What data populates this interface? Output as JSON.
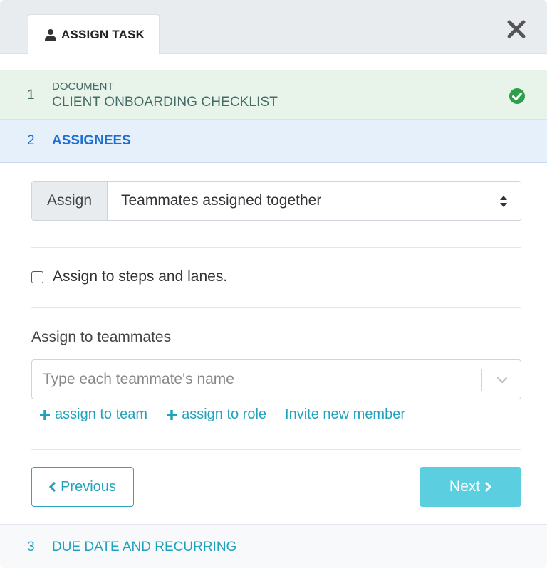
{
  "header": {
    "tab_label": "ASSIGN TASK",
    "tab_icon": "user-icon",
    "close_icon": "close-icon"
  },
  "steps": [
    {
      "number": "1",
      "subtitle": "DOCUMENT",
      "title": "CLIENT ONBOARDING CHECKLIST",
      "status": "complete"
    },
    {
      "number": "2",
      "title": "ASSIGNEES",
      "status": "active"
    },
    {
      "number": "3",
      "title": "DUE DATE AND RECURRING",
      "status": "pending"
    }
  ],
  "assign": {
    "addon_label": "Assign",
    "selected_value": "Teammates assigned together"
  },
  "steps_lanes": {
    "label": "Assign to steps and lanes.",
    "checked": false
  },
  "teammates": {
    "label": "Assign to teammates",
    "placeholder": "Type each teammate's name"
  },
  "links": {
    "assign_team": "assign to team",
    "assign_role": "assign to role",
    "invite": "Invite new member"
  },
  "footer": {
    "previous_label": "Previous",
    "next_label": "Next"
  },
  "colors": {
    "accent": "#1fa3bd",
    "next_button": "#5bcfe0",
    "active_step": "#1d6fd1",
    "complete_step_bg": "#e8f4e9",
    "check_green": "#2e9e4a"
  }
}
